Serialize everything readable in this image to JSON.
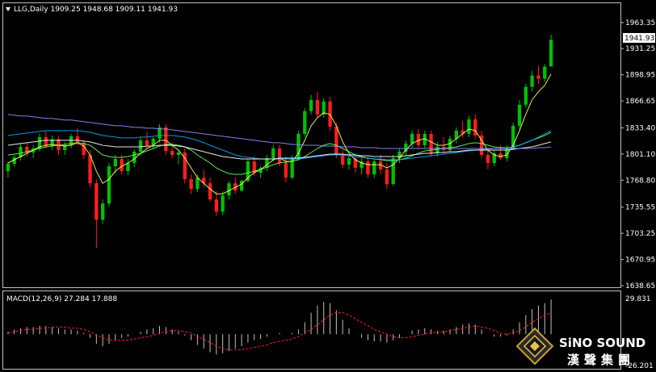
{
  "header": {
    "symbol_line": "LLG,Daily  1909.25 1948.68 1909.11 1941.93",
    "macd_line": "MACD(12,26,9) 27.284 17.888"
  },
  "colors": {
    "background": "#000000",
    "up_candle": "#00c000",
    "down_candle": "#ff1e1e",
    "ma_yellow": "#ffff66",
    "ma_cyan": "#00aaff",
    "ma_green": "#66ff66",
    "ma_white": "#ffffff",
    "macd_hist": "#c0c0c0",
    "macd_signal": "#ff2020",
    "grid_border": "#c0c0c0"
  },
  "price_axis": {
    "ticks": [
      "1963.35",
      "1931.25",
      "1898.95",
      "1866.65",
      "1833.40",
      "1801.10",
      "1768.80",
      "1735.55",
      "1703.25",
      "1670.95",
      "1638.65"
    ],
    "current_price_label": "1941.93",
    "range": [
      1638.65,
      1963.35
    ]
  },
  "macd_axis": {
    "top_label": "29.831",
    "bottom_label": "-26.201",
    "range": [
      -26.201,
      29.831
    ]
  },
  "logo": {
    "brand": "SiNO SOUND",
    "chinese": "漢聲集團",
    "icon": "diamond-logo-icon"
  },
  "chart_data": {
    "type": "candlestick",
    "title": "LLG,Daily",
    "ohlc_header": {
      "open": 1909.25,
      "high": 1948.68,
      "low": 1909.11,
      "close": 1941.93
    },
    "candles": [
      [
        1780,
        1792,
        1772,
        1789
      ],
      [
        1789,
        1800,
        1785,
        1797
      ],
      [
        1797,
        1815,
        1793,
        1810
      ],
      [
        1810,
        1815,
        1798,
        1803
      ],
      [
        1803,
        1812,
        1796,
        1808
      ],
      [
        1808,
        1826,
        1804,
        1822
      ],
      [
        1822,
        1830,
        1808,
        1811
      ],
      [
        1811,
        1824,
        1806,
        1819
      ],
      [
        1819,
        1823,
        1800,
        1806
      ],
      [
        1806,
        1816,
        1800,
        1812
      ],
      [
        1812,
        1826,
        1808,
        1823
      ],
      [
        1823,
        1833,
        1812,
        1815
      ],
      [
        1815,
        1818,
        1795,
        1800
      ],
      [
        1800,
        1806,
        1760,
        1765
      ],
      [
        1765,
        1770,
        1685,
        1720
      ],
      [
        1720,
        1745,
        1715,
        1740
      ],
      [
        1740,
        1790,
        1736,
        1786
      ],
      [
        1786,
        1800,
        1778,
        1795
      ],
      [
        1795,
        1800,
        1776,
        1780
      ],
      [
        1780,
        1795,
        1775,
        1790
      ],
      [
        1790,
        1807,
        1785,
        1804
      ],
      [
        1804,
        1822,
        1800,
        1818
      ],
      [
        1818,
        1828,
        1808,
        1812
      ],
      [
        1812,
        1822,
        1808,
        1820
      ],
      [
        1820,
        1838,
        1815,
        1834
      ],
      [
        1834,
        1838,
        1800,
        1805
      ],
      [
        1805,
        1815,
        1796,
        1800
      ],
      [
        1800,
        1806,
        1788,
        1803
      ],
      [
        1803,
        1808,
        1765,
        1770
      ],
      [
        1770,
        1776,
        1752,
        1758
      ],
      [
        1758,
        1776,
        1754,
        1772
      ],
      [
        1772,
        1782,
        1760,
        1765
      ],
      [
        1765,
        1772,
        1742,
        1745
      ],
      [
        1745,
        1755,
        1725,
        1730
      ],
      [
        1730,
        1755,
        1726,
        1750
      ],
      [
        1750,
        1768,
        1745,
        1765
      ],
      [
        1765,
        1772,
        1752,
        1756
      ],
      [
        1756,
        1770,
        1754,
        1768
      ],
      [
        1768,
        1795,
        1766,
        1792
      ],
      [
        1792,
        1798,
        1774,
        1778
      ],
      [
        1778,
        1786,
        1772,
        1784
      ],
      [
        1784,
        1800,
        1780,
        1796
      ],
      [
        1796,
        1812,
        1792,
        1808
      ],
      [
        1808,
        1812,
        1786,
        1790
      ],
      [
        1790,
        1798,
        1766,
        1772
      ],
      [
        1772,
        1800,
        1770,
        1796
      ],
      [
        1796,
        1830,
        1794,
        1826
      ],
      [
        1826,
        1858,
        1822,
        1854
      ],
      [
        1854,
        1874,
        1850,
        1868
      ],
      [
        1868,
        1878,
        1846,
        1850
      ],
      [
        1850,
        1870,
        1846,
        1866
      ],
      [
        1866,
        1872,
        1830,
        1835
      ],
      [
        1835,
        1840,
        1796,
        1800
      ],
      [
        1800,
        1806,
        1784,
        1788
      ],
      [
        1788,
        1800,
        1782,
        1796
      ],
      [
        1796,
        1800,
        1778,
        1784
      ],
      [
        1784,
        1796,
        1776,
        1792
      ],
      [
        1792,
        1798,
        1772,
        1776
      ],
      [
        1776,
        1796,
        1772,
        1792
      ],
      [
        1792,
        1800,
        1776,
        1782
      ],
      [
        1782,
        1790,
        1758,
        1764
      ],
      [
        1764,
        1800,
        1762,
        1796
      ],
      [
        1796,
        1808,
        1790,
        1804
      ],
      [
        1804,
        1818,
        1798,
        1814
      ],
      [
        1814,
        1830,
        1808,
        1826
      ],
      [
        1826,
        1832,
        1808,
        1812
      ],
      [
        1812,
        1830,
        1808,
        1826
      ],
      [
        1826,
        1830,
        1798,
        1802
      ],
      [
        1802,
        1816,
        1798,
        1810
      ],
      [
        1810,
        1822,
        1802,
        1806
      ],
      [
        1806,
        1824,
        1802,
        1820
      ],
      [
        1820,
        1834,
        1814,
        1830
      ],
      [
        1830,
        1842,
        1822,
        1826
      ],
      [
        1826,
        1848,
        1822,
        1844
      ],
      [
        1844,
        1850,
        1820,
        1824
      ],
      [
        1824,
        1830,
        1796,
        1800
      ],
      [
        1800,
        1806,
        1782,
        1790
      ],
      [
        1790,
        1806,
        1786,
        1802
      ],
      [
        1802,
        1812,
        1794,
        1796
      ],
      [
        1796,
        1812,
        1792,
        1808
      ],
      [
        1808,
        1840,
        1806,
        1836
      ],
      [
        1836,
        1868,
        1832,
        1862
      ],
      [
        1862,
        1888,
        1858,
        1884
      ],
      [
        1884,
        1904,
        1878,
        1898
      ],
      [
        1898,
        1910,
        1888,
        1894
      ],
      [
        1894,
        1912,
        1890,
        1909
      ],
      [
        1909.25,
        1948.68,
        1909.11,
        1941.93
      ]
    ],
    "series": [
      {
        "name": "",
        "color": "#ffff66",
        "values": [
          1790,
          1794,
          1798,
          1802,
          1806,
          1810,
          1812,
          1813,
          1812,
          1811,
          1812,
          1815,
          1811,
          1800,
          1780,
          1765,
          1770,
          1780,
          1786,
          1790,
          1795,
          1802,
          1808,
          1812,
          1818,
          1818,
          1812,
          1806,
          1796,
          1784,
          1772,
          1765,
          1758,
          1752,
          1752,
          1756,
          1760,
          1764,
          1772,
          1778,
          1782,
          1788,
          1794,
          1796,
          1792,
          1792,
          1802,
          1818,
          1836,
          1846,
          1852,
          1850,
          1836,
          1816,
          1802,
          1794,
          1790,
          1788,
          1788,
          1788,
          1784,
          1788,
          1796,
          1806,
          1814,
          1818,
          1820,
          1816,
          1812,
          1812,
          1814,
          1820,
          1826,
          1832,
          1830,
          1818,
          1806,
          1800,
          1798,
          1800,
          1812,
          1830,
          1850,
          1868,
          1878,
          1886,
          1900
        ]
      },
      {
        "name": "",
        "color": "#66ff66",
        "values": [
          1800,
          1801,
          1802,
          1804,
          1806,
          1808,
          1810,
          1811,
          1812,
          1813,
          1814,
          1815,
          1814,
          1812,
          1806,
          1800,
          1798,
          1797,
          1797,
          1798,
          1800,
          1802,
          1805,
          1808,
          1811,
          1813,
          1813,
          1812,
          1810,
          1806,
          1800,
          1795,
          1790,
          1784,
          1780,
          1777,
          1776,
          1776,
          1778,
          1780,
          1782,
          1785,
          1788,
          1790,
          1791,
          1792,
          1794,
          1798,
          1803,
          1808,
          1812,
          1814,
          1812,
          1808,
          1804,
          1800,
          1798,
          1796,
          1795,
          1794,
          1793,
          1793,
          1794,
          1796,
          1799,
          1802,
          1805,
          1806,
          1807,
          1808,
          1809,
          1810,
          1812,
          1814,
          1815,
          1814,
          1812,
          1810,
          1809,
          1809,
          1810,
          1812,
          1815,
          1818,
          1821,
          1824,
          1828
        ]
      },
      {
        "name": "",
        "color": "#00aaff",
        "values": [
          1824,
          1825,
          1826,
          1827,
          1828,
          1829,
          1830,
          1830,
          1830,
          1830,
          1830,
          1830,
          1829,
          1828,
          1826,
          1824,
          1823,
          1822,
          1821,
          1821,
          1821,
          1822,
          1822,
          1823,
          1824,
          1824,
          1824,
          1823,
          1822,
          1820,
          1818,
          1815,
          1812,
          1809,
          1806,
          1803,
          1800,
          1798,
          1797,
          1796,
          1795,
          1795,
          1795,
          1795,
          1795,
          1795,
          1795,
          1796,
          1797,
          1798,
          1799,
          1800,
          1800,
          1800,
          1799,
          1798,
          1797,
          1796,
          1795,
          1795,
          1794,
          1794,
          1794,
          1795,
          1796,
          1797,
          1798,
          1799,
          1800,
          1801,
          1802,
          1803,
          1804,
          1805,
          1806,
          1807,
          1807,
          1808,
          1808,
          1809,
          1810,
          1812,
          1815,
          1818,
          1822,
          1826,
          1830
        ]
      },
      {
        "name": "",
        "color": "#ffffff",
        "values": [
          1812,
          1813,
          1814,
          1815,
          1816,
          1817,
          1818,
          1818,
          1818,
          1818,
          1818,
          1818,
          1817,
          1816,
          1814,
          1812,
          1811,
          1810,
          1810,
          1810,
          1810,
          1810,
          1811,
          1811,
          1812,
          1812,
          1812,
          1811,
          1810,
          1808,
          1806,
          1804,
          1802,
          1800,
          1798,
          1797,
          1796,
          1795,
          1795,
          1795,
          1795,
          1795,
          1795,
          1796,
          1796,
          1796,
          1796,
          1797,
          1798,
          1799,
          1800,
          1801,
          1801,
          1801,
          1800,
          1800,
          1799,
          1799,
          1798,
          1798,
          1798,
          1798,
          1798,
          1799,
          1800,
          1801,
          1802,
          1802,
          1803,
          1803,
          1804,
          1804,
          1805,
          1806,
          1806,
          1806,
          1806,
          1806,
          1806,
          1806,
          1807,
          1808,
          1809,
          1810,
          1812,
          1814,
          1816
        ]
      },
      {
        "name": "",
        "color": "#9090ff",
        "values": [
          1850,
          1849,
          1848,
          1848,
          1847,
          1846,
          1845,
          1845,
          1844,
          1843,
          1843,
          1842,
          1841,
          1840,
          1839,
          1838,
          1837,
          1836,
          1836,
          1835,
          1834,
          1834,
          1833,
          1833,
          1832,
          1832,
          1831,
          1830,
          1829,
          1828,
          1827,
          1826,
          1825,
          1824,
          1823,
          1822,
          1821,
          1820,
          1819,
          1818,
          1817,
          1816,
          1815,
          1815,
          1814,
          1813,
          1813,
          1812,
          1812,
          1812,
          1811,
          1811,
          1811,
          1810,
          1810,
          1810,
          1809,
          1809,
          1809,
          1808,
          1808,
          1808,
          1808,
          1808,
          1808,
          1808,
          1808,
          1808,
          1808,
          1808,
          1808,
          1808,
          1808,
          1808,
          1808,
          1808,
          1808,
          1808,
          1808,
          1808,
          1808,
          1808,
          1808,
          1808,
          1809,
          1809,
          1810
        ]
      }
    ],
    "macd_histogram": [
      2,
      4,
      5,
      6,
      6,
      7,
      7,
      6,
      5,
      4,
      4,
      3,
      1,
      -3,
      -8,
      -10,
      -8,
      -5,
      -3,
      -2,
      0,
      2,
      4,
      5,
      7,
      6,
      4,
      2,
      -1,
      -5,
      -9,
      -12,
      -15,
      -17,
      -16,
      -14,
      -12,
      -10,
      -7,
      -5,
      -4,
      -2,
      0,
      1,
      0,
      1,
      4,
      10,
      18,
      24,
      27,
      26,
      20,
      12,
      5,
      0,
      -3,
      -5,
      -6,
      -6,
      -7,
      -5,
      -3,
      0,
      3,
      4,
      5,
      4,
      3,
      3,
      4,
      6,
      8,
      9,
      8,
      4,
      0,
      -2,
      -2,
      -1,
      4,
      10,
      16,
      21,
      24,
      26,
      29
    ],
    "macd_signal": [
      1,
      2,
      3,
      4,
      4,
      5,
      5,
      6,
      6,
      6,
      5,
      5,
      4,
      2,
      -1,
      -3,
      -5,
      -5,
      -5,
      -5,
      -4,
      -3,
      -2,
      -1,
      1,
      2,
      3,
      3,
      2,
      1,
      -2,
      -4,
      -7,
      -10,
      -12,
      -13,
      -13,
      -13,
      -12,
      -11,
      -10,
      -9,
      -7,
      -6,
      -5,
      -4,
      -2,
      1,
      4,
      8,
      12,
      16,
      18,
      18,
      16,
      13,
      10,
      7,
      4,
      2,
      0,
      -2,
      -3,
      -3,
      -2,
      -1,
      0,
      1,
      2,
      2,
      3,
      4,
      5,
      6,
      7,
      6,
      5,
      3,
      1,
      0,
      1,
      3,
      6,
      10,
      13,
      16,
      18
    ]
  }
}
